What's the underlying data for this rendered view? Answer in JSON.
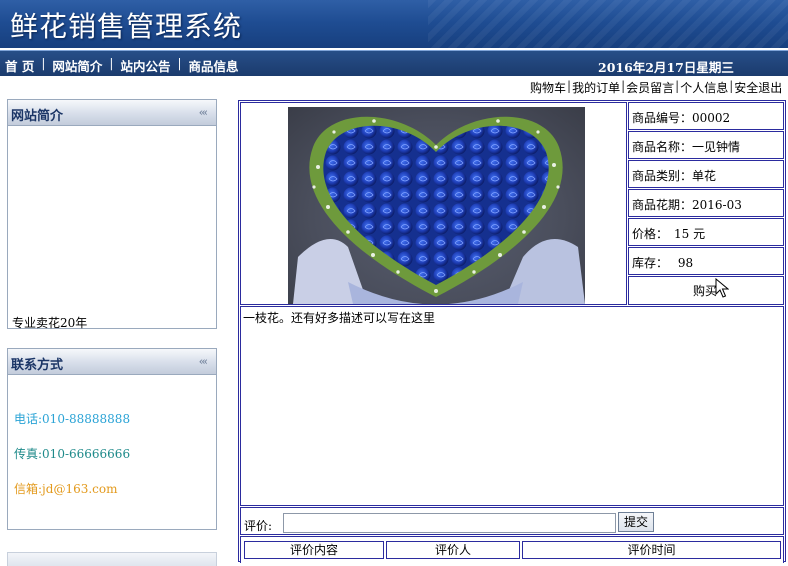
{
  "header": {
    "title": "鲜花销售管理系统"
  },
  "nav": {
    "items": [
      "首 页",
      "网站简介",
      "站内公告",
      "商品信息"
    ],
    "date": "2016年2月17日星期三"
  },
  "user_links": [
    "购物车",
    "我的订单",
    "会员留言",
    "个人信息",
    "安全退出"
  ],
  "sidebar": {
    "intro": {
      "title": "网站简介",
      "text": "专业卖花20年"
    },
    "contact": {
      "title": "联系方式",
      "phone": "电话:010-88888888",
      "fax": "传真:010-66666666",
      "email": "信箱:jd@163.com"
    },
    "colors": {
      "phone": "#2aa3d6",
      "fax": "#1e8a8a",
      "email": "#e39a1d"
    }
  },
  "product": {
    "image_icon": "blue-rose-heart-bouquet",
    "number": "商品编号：00002",
    "name": "商品名称：一见钟情",
    "category": "商品类别：单花",
    "season": "商品花期：2016-03",
    "price": "价格：　15 元",
    "stock": "库存：　 98",
    "buy_label": "购买",
    "description": "一枝花。还有好多描述可以写在这里"
  },
  "review": {
    "label": "评价:",
    "input_value": "",
    "submit_label": "提交",
    "columns": [
      "评价内容",
      "评价人",
      "评价时间"
    ]
  }
}
